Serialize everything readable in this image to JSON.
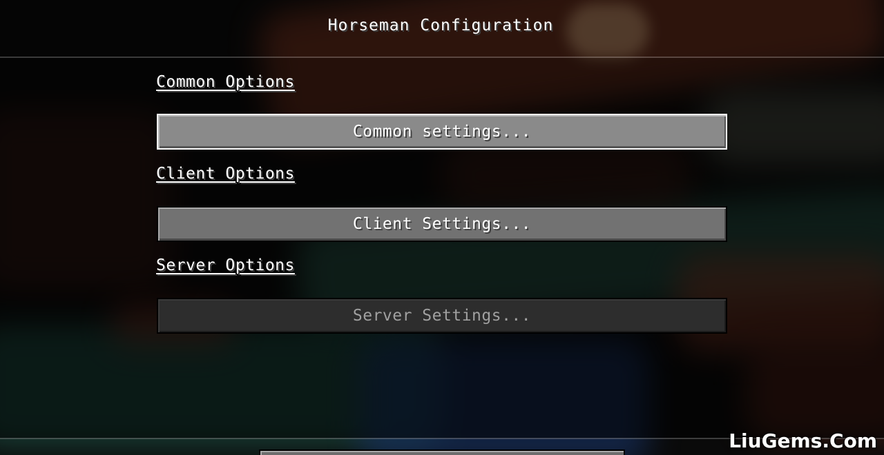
{
  "screen": {
    "title": "Horseman Configuration"
  },
  "sections": [
    {
      "label": "Common Options",
      "button": "Common settings..."
    },
    {
      "label": "Client Options",
      "button": "Client Settings..."
    },
    {
      "label": "Server Options",
      "button": "Server Settings...",
      "disabled": true
    }
  ],
  "watermark": "LiuGems.Com"
}
